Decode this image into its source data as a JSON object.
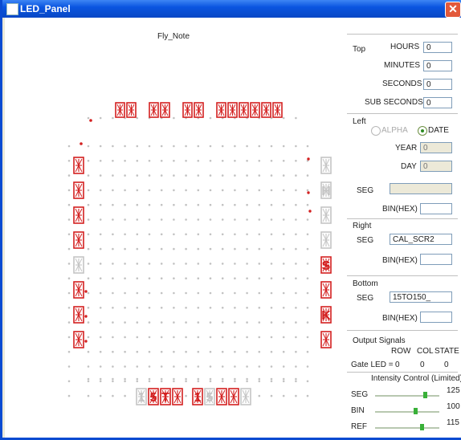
{
  "window": {
    "title": "LED_Panel",
    "close_glyph": "✕"
  },
  "display": {
    "title": "Fly_Note",
    "colors": {
      "lit": "#d32020",
      "unlit": "#c4c4c4",
      "dot": "#c2c2c2"
    },
    "top_groups": [
      {
        "digits": [
          true,
          true
        ]
      },
      {
        "digits": [
          true,
          true
        ]
      },
      {
        "digits": [
          true,
          true
        ]
      },
      {
        "digits": [
          true,
          true,
          true,
          true,
          true,
          true
        ]
      }
    ],
    "left_digits": [
      true,
      true,
      true,
      true,
      false,
      true,
      true,
      true
    ],
    "right_digits": [
      false,
      false,
      false,
      false,
      true,
      true,
      true,
      true
    ],
    "right_glyphs": [
      "",
      "H",
      "",
      "",
      "S",
      "",
      "K",
      ""
    ],
    "bottom_groups": [
      {
        "digits": [
          false,
          true,
          true,
          true
        ]
      },
      {
        "digits": [
          true,
          false,
          true,
          true,
          false
        ]
      }
    ],
    "bottom_glyphs": [
      "1",
      "5",
      "T",
      "",
      "1",
      "5",
      "",
      ""
    ]
  },
  "panel": {
    "top": {
      "legend": "Top",
      "fields": [
        {
          "label": "HOURS",
          "value": "0"
        },
        {
          "label": "MINUTES",
          "value": "0"
        },
        {
          "label": "SECONDS",
          "value": "0"
        },
        {
          "label": "SUB SECONDS",
          "value": "0"
        }
      ]
    },
    "left": {
      "legend": "Left",
      "radios": [
        {
          "label": "ALPHA",
          "checked": false,
          "enabled": false
        },
        {
          "label": "DATE",
          "checked": true,
          "enabled": true
        }
      ],
      "year_label": "YEAR",
      "year_value": "0",
      "day_label": "DAY",
      "day_value": "0",
      "seg_label": "SEG",
      "seg_value": "",
      "bin_label": "BIN(HEX)",
      "bin_value": ""
    },
    "right": {
      "legend": "Right",
      "seg_label": "SEG",
      "seg_value": "CAL_SCR2",
      "bin_label": "BIN(HEX)",
      "bin_value": ""
    },
    "bottom": {
      "legend": "Bottom",
      "seg_label": "SEG",
      "seg_value": "15TO150_",
      "bin_label": "BIN(HEX)",
      "bin_value": ""
    },
    "output": {
      "legend": "Output Signals",
      "headers": [
        "ROW",
        "COL",
        "STATE"
      ],
      "row_label": "Gate LED =",
      "values": [
        "0",
        "0",
        "0"
      ]
    },
    "intensity": {
      "legend": "Intensity Control (Limited)",
      "sliders": [
        {
          "label": "SEG",
          "value": "125",
          "level": 0.78
        },
        {
          "label": "BIN",
          "value": "100",
          "level": 0.62
        },
        {
          "label": "REF",
          "value": "115",
          "level": 0.72
        }
      ]
    }
  }
}
